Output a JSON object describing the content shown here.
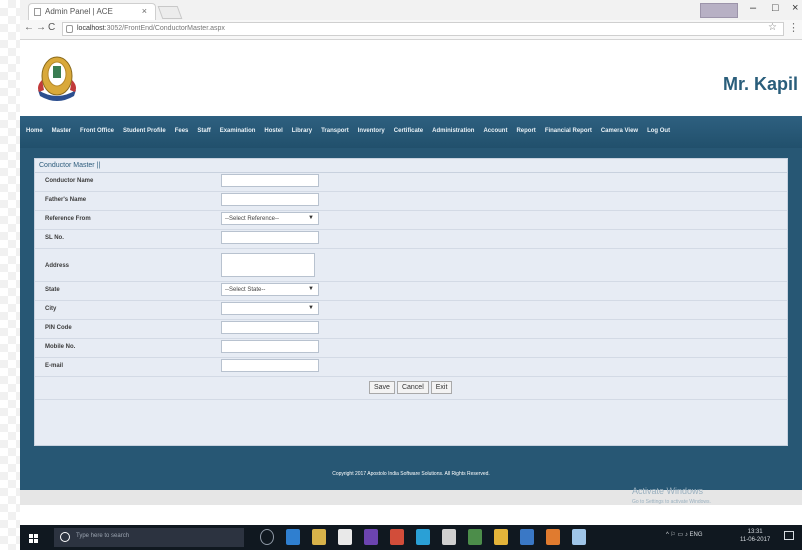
{
  "browser": {
    "tab_title": "Admin Panel | ACE",
    "tab_close": "×",
    "window_min": "–",
    "window_max": "□",
    "window_close": "×",
    "url_host": "localhost",
    "url_path": ":3052/FrontEnd/ConductorMaster.aspx",
    "nav_back": "←",
    "nav_fwd": "→",
    "nav_reload": "C"
  },
  "header": {
    "user_name": "Mr. Kapil"
  },
  "nav": {
    "items": [
      "Home",
      "Master",
      "Front Office",
      "Student Profile",
      "Fees",
      "Staff",
      "Examination",
      "Hostel",
      "Library",
      "Transport",
      "Inventory",
      "Certificate",
      "Administration",
      "Account",
      "Report",
      "Financial Report",
      "Camera View",
      "Log Out"
    ]
  },
  "form": {
    "title": "Conductor Master ||",
    "fields": {
      "conductor_name": "Conductor Name",
      "fathers_name": "Father's Name",
      "reference_from": "Reference From",
      "sl_no": "SL No.",
      "address": "Address",
      "state": "State",
      "city": "City",
      "pin_code": "PIN Code",
      "mobile_no": "Mobile No.",
      "email": "E-mail"
    },
    "reference_select": "--Select Reference--",
    "state_select": "--Select State--",
    "city_select": "",
    "buttons": {
      "save": "Save",
      "cancel": "Cancel",
      "exit": "Exit"
    }
  },
  "footer": {
    "copyright": "Copyright 2017 Apostolo India Software Solutions. All Rights Reserved.",
    "activate_title": "Activate Windows",
    "activate_sub": "Go to Settings to activate Windows."
  },
  "taskbar": {
    "search_placeholder": "Type here to search",
    "tray": "^ ⚐ ▭ ♪ ENG",
    "time": "13:31",
    "date": "11-06-2017"
  },
  "colors": {
    "navbar": "#2e6080",
    "content": "#275774",
    "panel": "#e7ecf4",
    "brand_text": "#2a5e7b"
  }
}
